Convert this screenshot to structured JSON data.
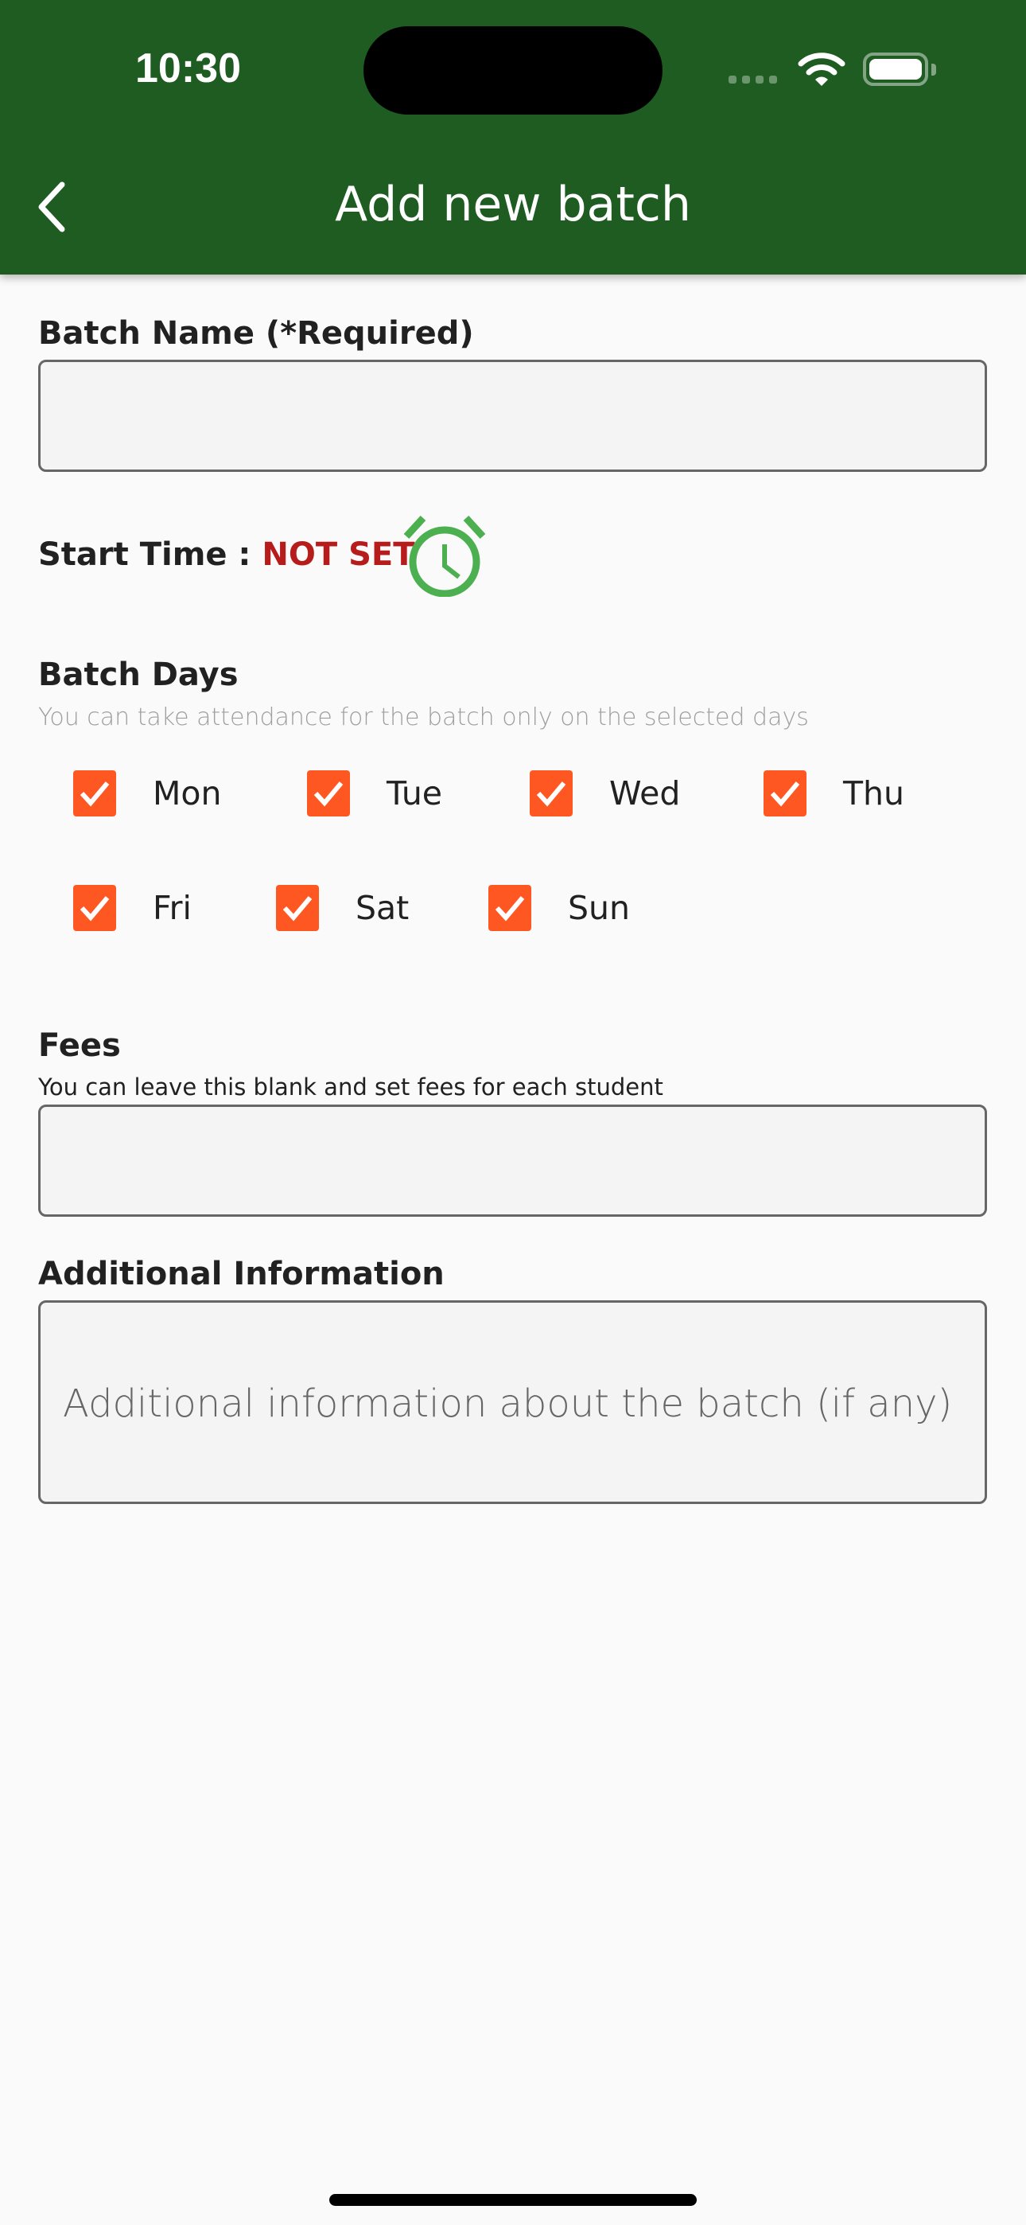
{
  "status_bar": {
    "time": "10:30",
    "icons": [
      "signal-icon",
      "wifi-icon",
      "battery-icon"
    ]
  },
  "header": {
    "title": "Add new batch",
    "back_icon": "chevron-left-icon",
    "background_color": "#1e5c21"
  },
  "form": {
    "batch_name": {
      "label": "Batch Name (*Required)",
      "value": "",
      "placeholder": ""
    },
    "start_time": {
      "label": "Start Time :",
      "value": "NOT SET",
      "value_color": "#b71c1c",
      "icon": "alarm-clock-icon",
      "icon_color": "#4caf50"
    },
    "batch_days": {
      "label": "Batch Days",
      "subtitle": "You can take attendance for the batch only on the selected days",
      "checkbox_color": "#ff5722",
      "days": [
        {
          "label": "Mon",
          "checked": true
        },
        {
          "label": "Tue",
          "checked": true
        },
        {
          "label": "Wed",
          "checked": true
        },
        {
          "label": "Thu",
          "checked": true
        },
        {
          "label": "Fri",
          "checked": true
        },
        {
          "label": "Sat",
          "checked": true
        },
        {
          "label": "Sun",
          "checked": true
        }
      ]
    },
    "fees": {
      "label": "Fees",
      "subtitle": "You can leave this blank and set fees for each student",
      "value": "",
      "placeholder": ""
    },
    "additional_info": {
      "label": "Additional Information",
      "value": "",
      "placeholder": "Additional information about the batch (if any)"
    }
  }
}
